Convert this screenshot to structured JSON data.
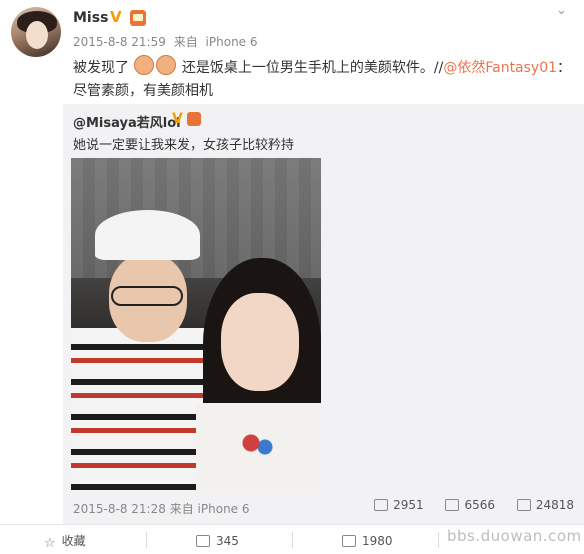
{
  "post": {
    "author": "Miss",
    "verified_mark": "V",
    "time": "2015-8-8 21:59",
    "source_prefix": "来自",
    "source": "iPhone 6",
    "text_part1": "被发现了",
    "text_part2": "还是饭桌上一位男生手机上的美颜软件。//",
    "mention": "@依然Fantasy01",
    "text_part3": "：尽管素颜，有美颜相机",
    "caret_icon": "chevron-down-icon"
  },
  "repost": {
    "author": "@Misaya若风lol",
    "verified_mark": "V",
    "text": "她说一定要让我来发，女孩子比较矜持",
    "time": "2015-8-8 21:28",
    "source_prefix": "来自",
    "source": "iPhone 6",
    "reposts": "2951",
    "comments": "6566",
    "likes": "24818"
  },
  "actions": {
    "favorite": "收藏",
    "repost": "345",
    "comment": "1980"
  },
  "watermark": "bbs.duowan.com",
  "colors": {
    "mention": "#eb7350",
    "verified": "#f0a000",
    "repost_bg": "#f2f2f5"
  }
}
